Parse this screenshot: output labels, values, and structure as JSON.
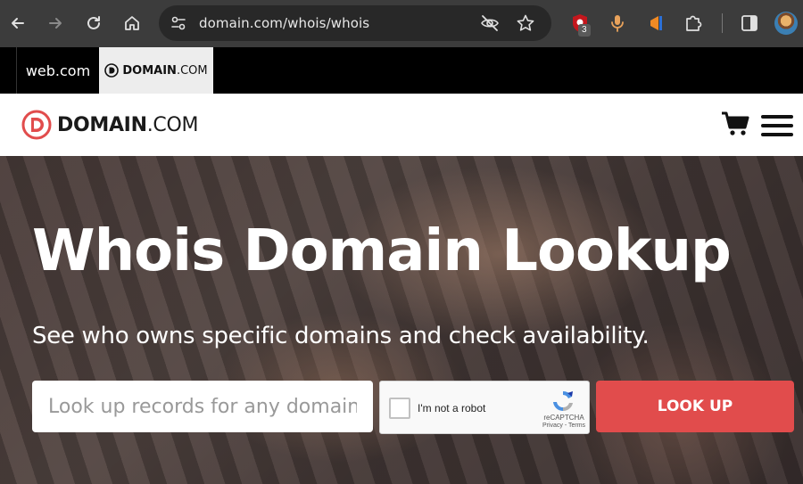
{
  "browser": {
    "url": "domain.com/whois/whois",
    "extension_badge": "3"
  },
  "brand_tabs": {
    "web": "web.com",
    "domain_bold": "DOMAIN",
    "domain_thin": ".COM"
  },
  "header": {
    "logo_bold": "DOMAIN",
    "logo_thin": ".COM"
  },
  "hero": {
    "title": "Whois Domain Lookup",
    "subtitle": "See who owns specific domains and check availability.",
    "search_placeholder": "Look up records for any domain",
    "search_value": "",
    "captcha_label": "I'm not a robot",
    "captcha_brand": "reCAPTCHA",
    "captcha_links": "Privacy - Terms",
    "button_label": "LOOK UP"
  },
  "colors": {
    "brand_red": "#e14c4c",
    "chrome_bg": "#3c3c3c",
    "omnibox_bg": "#282828"
  },
  "icons": [
    "back-arrow-icon",
    "forward-arrow-icon",
    "reload-icon",
    "home-icon",
    "site-settings-icon",
    "eye-off-icon",
    "star-icon",
    "ublock-icon",
    "microphone-icon",
    "extension-icon",
    "puzzle-icon",
    "side-panel-icon",
    "cart-icon",
    "hamburger-menu-icon"
  ]
}
